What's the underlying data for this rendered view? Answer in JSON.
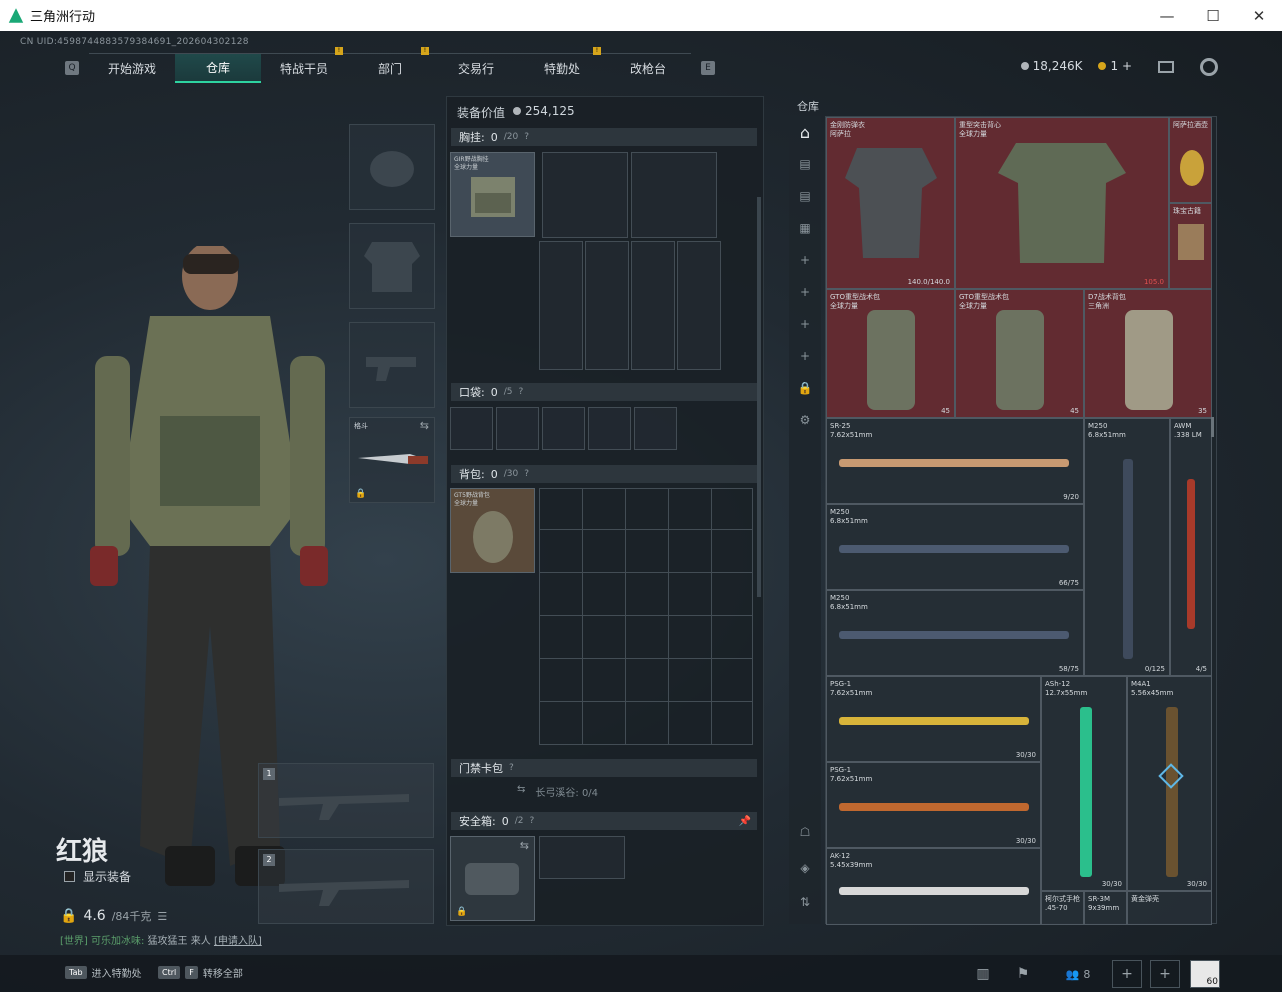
{
  "window": {
    "title": "三角洲行动",
    "minimize": "—",
    "maximize": "☐",
    "close": "✕"
  },
  "uid": "CN UID:4598744883579384691_202604302128",
  "nav": {
    "tabs": [
      "开始游戏",
      "仓库",
      "特战干员",
      "部门",
      "交易行",
      "特勤处",
      "改枪台"
    ],
    "active": "仓库",
    "badges": [
      "!",
      "!",
      "!"
    ]
  },
  "currency": {
    "silver": "18,246K",
    "gold": "1",
    "plus": "+"
  },
  "operator": {
    "name": "红狼",
    "show_equipment": "显示装备",
    "weight": "4.6",
    "weight_max": "/84千克",
    "chat_channel": "[世界]",
    "chat_user": "可乐加冰味:",
    "chat_text": "猛攻猛王 来人",
    "chat_link": "[申请入队]"
  },
  "melee": {
    "label": "格斗"
  },
  "gun_slots": [
    "1",
    "2"
  ],
  "equip_value": {
    "label": "装备价值",
    "value": "254,125"
  },
  "sections": {
    "chest": {
      "label": "胸挂:",
      "value": "0",
      "max": "/20",
      "help": "?"
    },
    "pocket": {
      "label": "口袋:",
      "value": "0",
      "max": "/5",
      "help": "?"
    },
    "backpack": {
      "label": "背包:",
      "value": "0",
      "max": "/30",
      "help": "?"
    },
    "keycard": {
      "label": "门禁卡包",
      "help": "?",
      "capacity": "长弓溪谷: 0/4"
    },
    "safe": {
      "label": "安全箱:",
      "value": "0",
      "max": "/2",
      "help": "?"
    }
  },
  "chest_item": {
    "label": "GIR野战胸挂\n全球力量"
  },
  "backpack_item": {
    "label": "GT5野战背包\n全球力量"
  },
  "warehouse": {
    "title": "仓库",
    "items": [
      {
        "label": "金刚防弹衣\n阿萨拉",
        "count": "140.0/140.0"
      },
      {
        "label": "重型突击背心\n全球力量",
        "count": "105.0"
      },
      {
        "label": "阿萨拉酒壶",
        "count": ""
      },
      {
        "label": "珠宝古籍",
        "count": ""
      },
      {
        "label": "GTO重型战术包\n全球力量",
        "count": "45"
      },
      {
        "label": "GTO重型战术包\n全球力量",
        "count": "45"
      },
      {
        "label": "D7战术背包\n三角洲",
        "count": "35"
      },
      {
        "label": "SR-25\n7.62x51mm",
        "count": "9/20"
      },
      {
        "label": "M250\n6.8x51mm",
        "count": "0/125"
      },
      {
        "label": "AWM\n.338 LM",
        "count": "4/5"
      },
      {
        "label": "M250\n6.8x51mm",
        "count": "66/75"
      },
      {
        "label": "M250\n6.8x51mm",
        "count": "58/75"
      },
      {
        "label": "PSG-1\n7.62x51mm",
        "count": "30/30"
      },
      {
        "label": "ASh-12\n12.7x55mm",
        "count": "30/30"
      },
      {
        "label": "M4A1\n5.56x45mm",
        "count": "30/30"
      },
      {
        "label": "PSG-1\n7.62x51mm",
        "count": "30/30"
      },
      {
        "label": "AK-12\n5.45x39mm",
        "count": ""
      },
      {
        "label": "柯尔式手枪\n.45-70",
        "count": ""
      },
      {
        "label": "SR-3M\n9x39mm",
        "count": ""
      },
      {
        "label": "黄金弹壳",
        "count": ""
      }
    ]
  },
  "bottom": {
    "tab_key": "Tab",
    "tab_label": "进入特勤处",
    "ctrl_key": "Ctrl",
    "f_key": "F",
    "ctrl_label": "转移全部",
    "friends": "8",
    "level": "60"
  },
  "colors": {
    "accent": "#2ed3a0",
    "badge": "#d6a51b",
    "red_item": "#6e2d32"
  }
}
